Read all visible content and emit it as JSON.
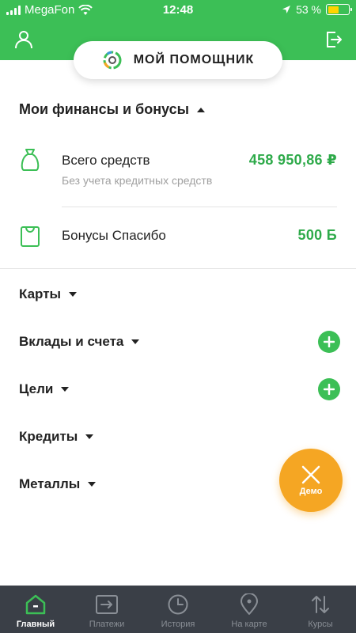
{
  "status_bar": {
    "carrier": "MegaFon",
    "time": "12:48",
    "battery_percent": "53 %",
    "battery_level": 0.53
  },
  "header": {
    "assistant_label": "МОЙ ПОМОЩНИК"
  },
  "finances": {
    "title": "Мои финансы и бонусы",
    "total": {
      "label": "Всего средств",
      "sublabel": "Без учета кредитных средств",
      "value": "458 950,86 ₽"
    },
    "bonuses": {
      "label": "Бонусы Спасибо",
      "value": "500 Б"
    }
  },
  "categories": [
    {
      "label": "Карты",
      "has_add": false
    },
    {
      "label": "Вклады и счета",
      "has_add": true
    },
    {
      "label": "Цели",
      "has_add": true
    },
    {
      "label": "Кредиты",
      "has_add": false
    },
    {
      "label": "Металлы",
      "has_add": false
    }
  ],
  "demo_button": {
    "label": "Демо"
  },
  "tabs": [
    {
      "label": "Главный",
      "icon": "home-icon",
      "active": true
    },
    {
      "label": "Платежи",
      "icon": "payments-icon",
      "active": false
    },
    {
      "label": "История",
      "icon": "clock-icon",
      "active": false
    },
    {
      "label": "На карте",
      "icon": "map-pin-icon",
      "active": false
    },
    {
      "label": "Курсы",
      "icon": "exchange-arrows-icon",
      "active": false
    }
  ],
  "colors": {
    "brand_green": "#3cbf56",
    "value_green": "#2eaa4a",
    "demo_orange": "#f5a623",
    "tabbar_bg": "#3a3f47"
  }
}
